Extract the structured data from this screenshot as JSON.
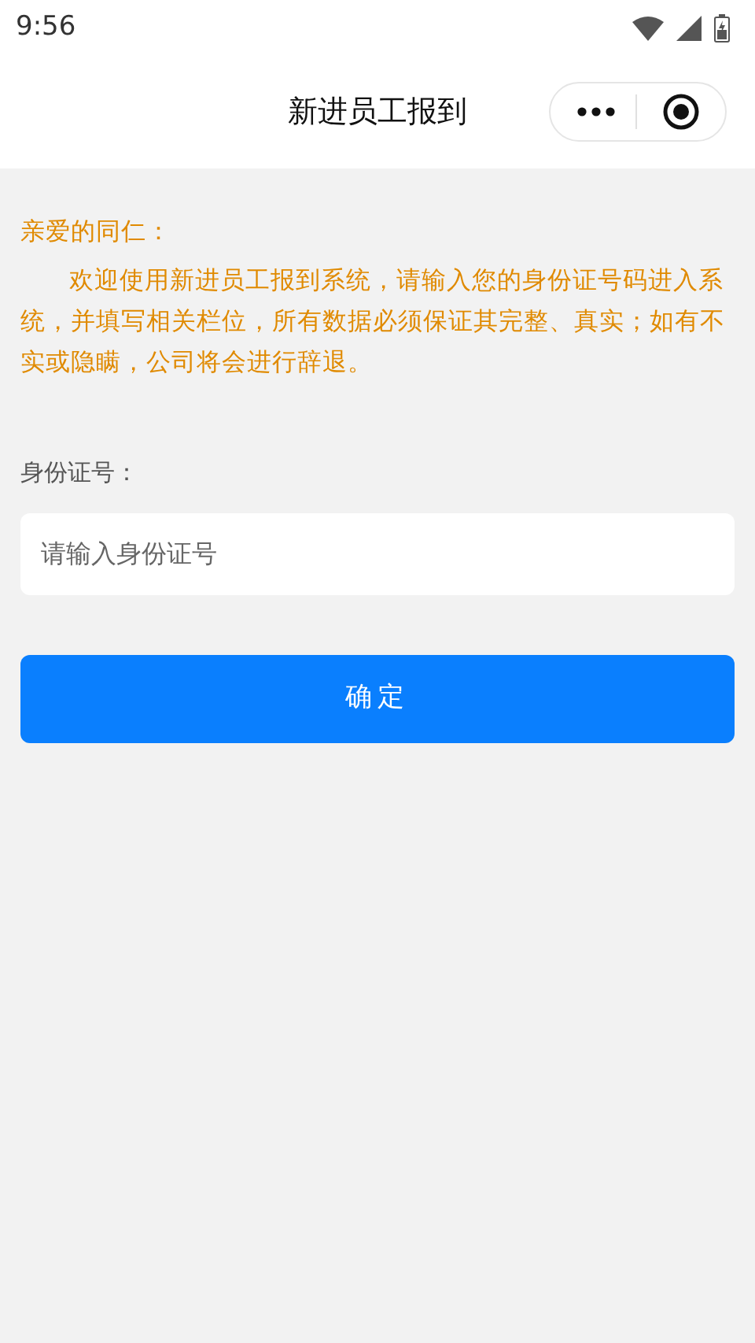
{
  "status_bar": {
    "time": "9:56"
  },
  "nav": {
    "title": "新进员工报到"
  },
  "notice": {
    "greeting": "亲爱的同仁：",
    "body": "欢迎使用新进员工报到系统，请输入您的身份证号码进入系统，并填写相关栏位，所有数据必须保证其完整、真实；如有不实或隐瞒，公司将会进行辞退。"
  },
  "form": {
    "label": "身份证号：",
    "placeholder": "请输入身份证号"
  },
  "buttons": [
    "确定"
  ]
}
